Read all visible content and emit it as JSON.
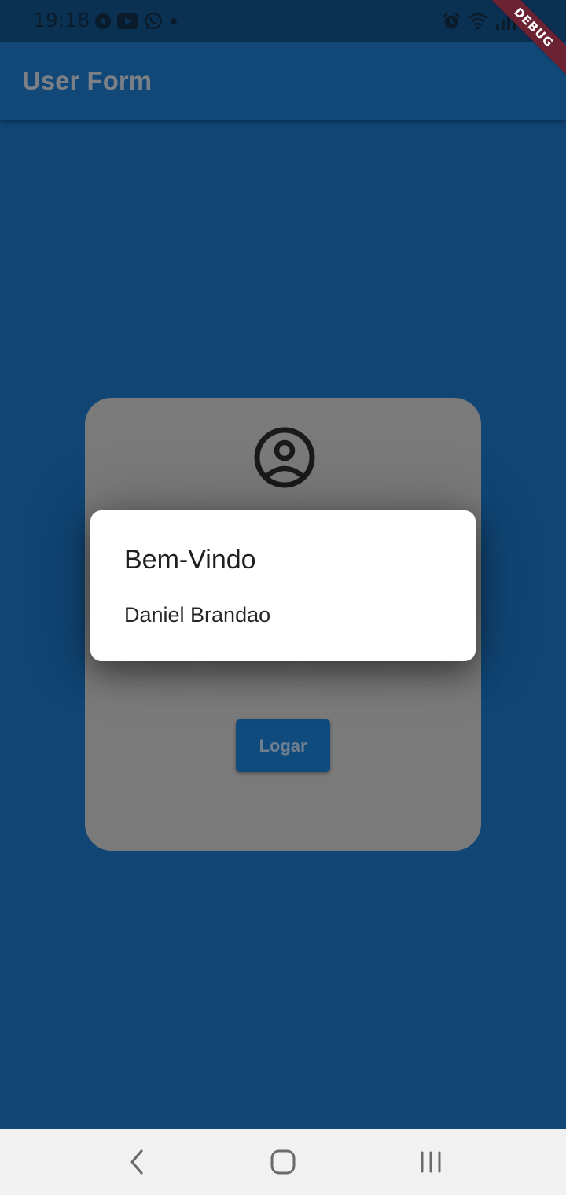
{
  "status_bar": {
    "time": "19:18",
    "left_icons": [
      "soccer-ball-icon",
      "youtube-icon",
      "whatsapp-icon",
      "dot-icon"
    ],
    "right_icons": [
      "alarm-icon",
      "wifi-icon",
      "signal-icon"
    ]
  },
  "app_bar": {
    "title": "User Form"
  },
  "debug_banner": {
    "label": "DEBUG"
  },
  "card": {
    "icon": "account-circle-icon",
    "button_label": "Logar"
  },
  "dialog": {
    "title": "Bem-Vindo",
    "content": "Daniel Brandao"
  },
  "nav_bar": {
    "buttons": [
      "back-icon",
      "home-icon",
      "recent-apps-icon"
    ]
  },
  "colors": {
    "background": "#104574",
    "status_bar": "#0b3152",
    "app_bar": "#114878",
    "card": "#7a7a7a",
    "dialog": "#ffffff",
    "debug_banner": "#6b2233",
    "nav_bar": "#f1f1f1"
  }
}
